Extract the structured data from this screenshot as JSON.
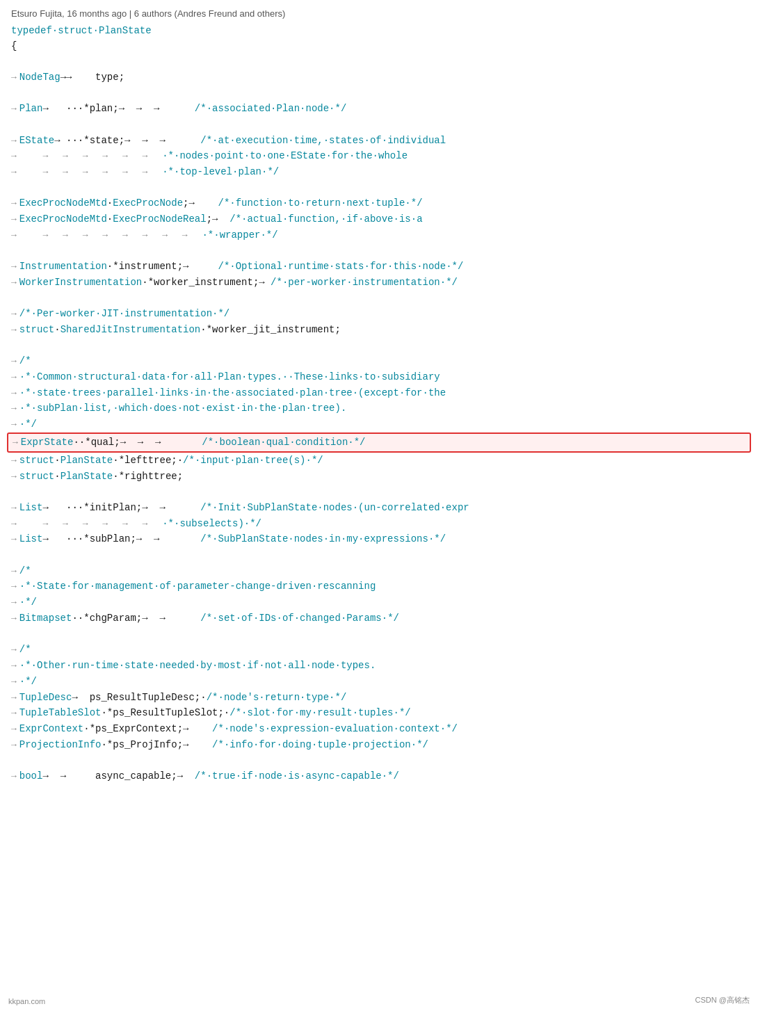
{
  "header": {
    "meta": "Etsuro Fujita, 16 months ago | 6 authors (Andres Freund and others)"
  },
  "footer": {
    "logo": "CSDN @高铭杰",
    "watermark": "kkpan.com"
  },
  "code": {
    "lines": [
      {
        "type": "struct_def",
        "text": "typedef·struct·PlanState"
      },
      {
        "type": "brace_open",
        "text": "{"
      },
      {
        "type": "blank"
      },
      {
        "type": "field",
        "indent": 1,
        "text": "NodeTag→→\ttype;"
      },
      {
        "type": "blank"
      },
      {
        "type": "field",
        "indent": 1,
        "text": "Plan→\t···*plan;→\t→\t→\t/*·associated·Plan·node·*/"
      },
      {
        "type": "blank"
      },
      {
        "type": "field",
        "indent": 1,
        "text": "EState→\t···*state;→\t→\t→\t/*·at·execution·time,·states·of·individual"
      },
      {
        "type": "cont",
        "indent": 2,
        "text": "·*·nodes·point·to·one·EState·for·the·whole"
      },
      {
        "type": "cont",
        "indent": 2,
        "text": "·*·top-level·plan·*/"
      },
      {
        "type": "blank"
      },
      {
        "type": "field",
        "indent": 1,
        "text": "ExecProcNodeMtd·ExecProcNode;→\t/*·function·to·return·next·tuple·*/"
      },
      {
        "type": "field",
        "indent": 1,
        "text": "ExecProcNodeMtd·ExecProcNodeReal;→\t/*·actual·function,·if·above·is·a"
      },
      {
        "type": "cont",
        "indent": 2,
        "text": "·*·wrapper·*/"
      },
      {
        "type": "blank"
      },
      {
        "type": "field",
        "indent": 1,
        "text": "Instrumentation·*instrument;→\t/*·Optional·runtime·stats·for·this·node·*/"
      },
      {
        "type": "field",
        "indent": 1,
        "text": "WorkerInstrumentation·*worker_instrument;→\t/*·per-worker·instrumentation·*/"
      },
      {
        "type": "blank"
      },
      {
        "type": "field",
        "indent": 1,
        "text": "/*·Per-worker·JIT·instrumentation·*/"
      },
      {
        "type": "field",
        "indent": 1,
        "text": "struct·SharedJitInstrumentation·*worker_jit_instrument;"
      },
      {
        "type": "blank"
      },
      {
        "type": "field",
        "indent": 1,
        "text": "/*"
      },
      {
        "type": "cont",
        "indent": 1,
        "text": "·*·Common·structural·data·for·all·Plan·types.··These·links·to·subsidiary"
      },
      {
        "type": "cont",
        "indent": 1,
        "text": "·*·state·trees·parallel·links·in·the·associated·plan·tree·(except·for·the"
      },
      {
        "type": "cont",
        "indent": 1,
        "text": "·*·subPlan·list,·which·does·not·exist·in·the·plan·tree)."
      },
      {
        "type": "cont",
        "indent": 1,
        "text": "·*/"
      },
      {
        "type": "highlighted",
        "text": "ExprState··*qual;→\t→\t→\t/*·boolean·qual·condition·*/"
      },
      {
        "type": "field",
        "indent": 1,
        "text": "struct·PlanState·*lefttree;·/*·input·plan·tree(s)·*/"
      },
      {
        "type": "field",
        "indent": 1,
        "text": "struct·PlanState·*righttree;"
      },
      {
        "type": "blank"
      },
      {
        "type": "field",
        "indent": 1,
        "text": "List→\t···*initPlan;→\t→\t/*·Init·SubPlanState·nodes·(un-correlated·expr"
      },
      {
        "type": "cont",
        "indent": 2,
        "text": "·*·subselects)·*/"
      },
      {
        "type": "field",
        "indent": 1,
        "text": "List→\t···*subPlan;→\t→\t/*·SubPlanState·nodes·in·my·expressions·*/"
      },
      {
        "type": "blank"
      },
      {
        "type": "field",
        "indent": 1,
        "text": "/*"
      },
      {
        "type": "cont",
        "indent": 1,
        "text": "·*·State·for·management·of·parameter-change-driven·rescanning"
      },
      {
        "type": "cont",
        "indent": 1,
        "text": "·*/"
      },
      {
        "type": "field",
        "indent": 1,
        "text": "Bitmapset··*chgParam;→\t→\t/*·set·of·IDs·of·changed·Params·*/"
      },
      {
        "type": "blank"
      },
      {
        "type": "field",
        "indent": 1,
        "text": "/*"
      },
      {
        "type": "cont",
        "indent": 1,
        "text": "·*·Other·run-time·state·needed·by·most·if·not·all·node·types."
      },
      {
        "type": "cont",
        "indent": 1,
        "text": "·*/"
      },
      {
        "type": "field",
        "indent": 1,
        "text": "TupleDesc→\tps_ResultTupleDesc;·/*·node's·return·type·*/"
      },
      {
        "type": "field",
        "indent": 1,
        "text": "TupleTableSlot·*ps_ResultTupleSlot;·/*·slot·for·my·result·tuples·*/"
      },
      {
        "type": "field",
        "indent": 1,
        "text": "ExprContext·*ps_ExprContext;→\t/*·node's·expression-evaluation·context·*/"
      },
      {
        "type": "field",
        "indent": 1,
        "text": "ProjectionInfo·*ps_ProjInfo;→\t/*·info·for·doing·tuple·projection·*/"
      },
      {
        "type": "blank"
      },
      {
        "type": "field",
        "indent": 1,
        "text": "bool→\t→\tasync_capable;→\t/*·true·if·node·is·async-capable·*/"
      }
    ]
  }
}
